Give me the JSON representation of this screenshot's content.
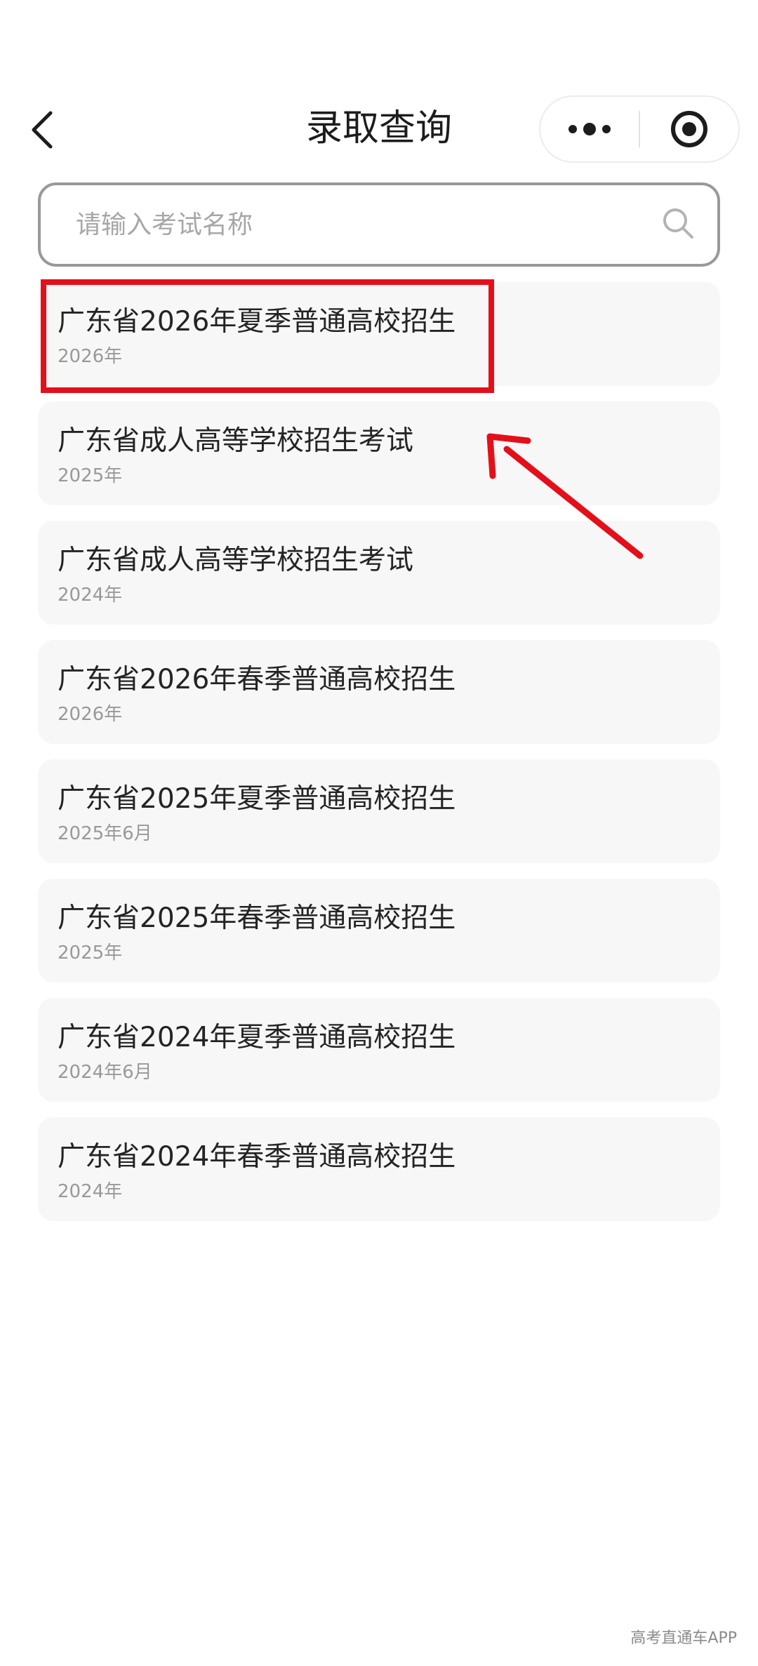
{
  "header": {
    "title": "录取查询",
    "back_icon": "chevron-left-icon",
    "more_icon": "more-dots-icon",
    "target_icon": "target-icon"
  },
  "search": {
    "placeholder": "请输入考试名称",
    "value": "",
    "icon": "search-icon"
  },
  "exams": [
    {
      "title": "广东省2026年夏季普通高校招生",
      "date": "2026年"
    },
    {
      "title": "广东省成人高等学校招生考试",
      "date": "2025年"
    },
    {
      "title": "广东省成人高等学校招生考试",
      "date": "2024年"
    },
    {
      "title": "广东省2026年春季普通高校招生",
      "date": "2026年"
    },
    {
      "title": "广东省2025年夏季普通高校招生",
      "date": "2025年6月"
    },
    {
      "title": "广东省2025年春季普通高校招生",
      "date": "2025年"
    },
    {
      "title": "广东省2024年夏季普通高校招生",
      "date": "2024年6月"
    },
    {
      "title": "广东省2024年春季普通高校招生",
      "date": "2024年"
    }
  ],
  "annotation": {
    "color": "#e3101a",
    "highlighted_item_index": 0
  },
  "watermark": "高考直通车APP"
}
